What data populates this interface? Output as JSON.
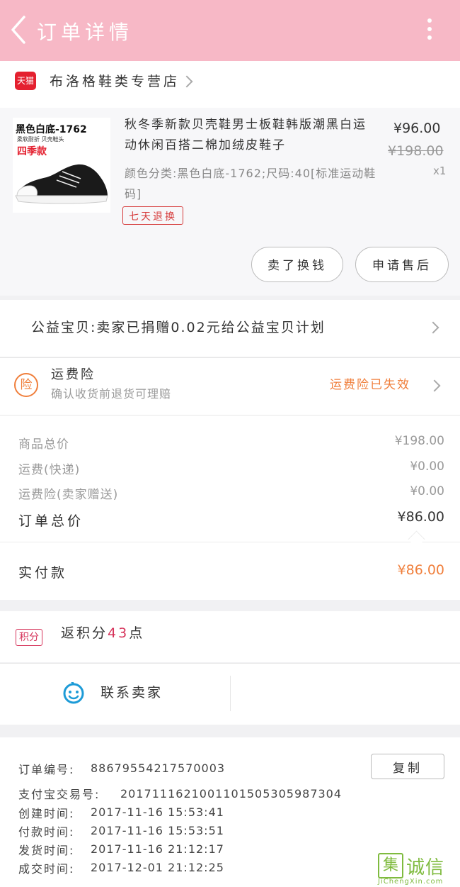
{
  "header": {
    "title": "订单详情",
    "back_icon": "chevron-left-icon",
    "more_icon": "more-vertical-icon",
    "bg_color": "#f7b8c6"
  },
  "shop": {
    "platform_badge": "天猫",
    "name": "布洛格鞋类专营店"
  },
  "product": {
    "image_caption_line1": "黑色白底-1762",
    "image_caption_line2": "柔软耐折 贝壳鞋头",
    "image_caption_line3": "四季款",
    "title": "秋冬季新款贝壳鞋男士板鞋韩版潮黑白运动休闲百搭二棉加绒皮鞋子",
    "sku": "颜色分类:黑色白底-1762;尺码:40[标准运动鞋码]",
    "tag": "七天退换",
    "price": "¥96.00",
    "original_price": "¥198.00",
    "quantity": "x1",
    "buttons": {
      "refund": "卖了换钱",
      "after_sale": "申请售后"
    }
  },
  "charity": {
    "text": "公益宝贝:卖家已捐赠0.02元给公益宝贝计划"
  },
  "insurance": {
    "icon_text": "险",
    "title": "运费险",
    "subtitle": "确认收货前退货可理赔",
    "status": "运费险已失效",
    "status_color": "#f07f3c"
  },
  "summary": {
    "rows": [
      {
        "label": "商品总价",
        "amount": "¥198.00"
      },
      {
        "label": "运费(快递)",
        "amount": "¥0.00"
      },
      {
        "label": "运费险(卖家赠送)",
        "amount": "¥0.00"
      }
    ],
    "total_label": "订单总价",
    "total_amount": "¥86.00",
    "paid_label": "实付款",
    "paid_amount": "¥86.00",
    "paid_color": "#f07f3c"
  },
  "points": {
    "badge": "积分",
    "prefix": "返积分",
    "value": "43",
    "suffix": "点"
  },
  "contact": {
    "label": "联系卖家",
    "icon": "chat-smile-icon"
  },
  "order_info": {
    "copy_button": "复制",
    "rows": [
      {
        "label": "订单编号:",
        "value": "88679554217570003"
      },
      {
        "label": "支付宝交易号:",
        "value": "2017111621001101505305987304"
      },
      {
        "label": "创建时间:",
        "value": "2017-11-16 15:53:41"
      },
      {
        "label": "付款时间:",
        "value": "2017-11-16 15:53:51"
      },
      {
        "label": "发货时间:",
        "value": "2017-11-16 21:12:17"
      },
      {
        "label": "成交时间:",
        "value": "2017-12-01 21:12:25"
      }
    ]
  },
  "watermark": {
    "mark": "集",
    "name": "诚信",
    "url": "JiChengXin.com",
    "color": "#7fbb3f"
  }
}
